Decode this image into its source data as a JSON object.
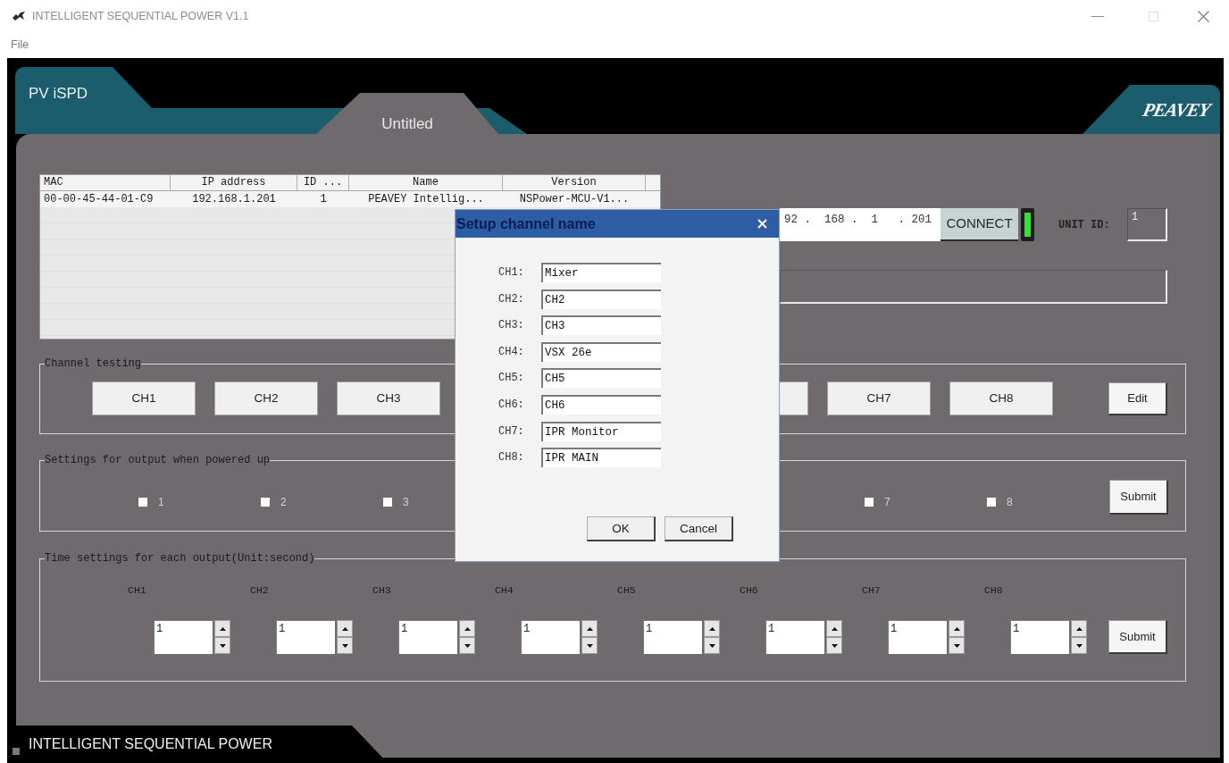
{
  "window": {
    "title": "INTELLIGENT SEQUENTIAL POWER V1.1"
  },
  "menu": [
    {
      "label": "File"
    }
  ],
  "header": {
    "app_name": "PV iSPD",
    "tab": {
      "label": "Untitled",
      "selected": true
    },
    "logo_text": "PEAVEY"
  },
  "device_table": {
    "columns": [
      "MAC",
      "IP address",
      "ID ...",
      "Name",
      "Version"
    ],
    "rows": [
      {
        "cells": [
          "00-00-45-44-01-C9",
          "192.168.1.201",
          "1",
          "PEAVEY Intellig...",
          "NSPower-MCU-V1..."
        ]
      }
    ]
  },
  "connection": {
    "ip_address": "92 .  168 .  1   . 201",
    "connect_button": "CONNECT",
    "connected": true,
    "unit_id_label": "UNIT ID:",
    "unit_id": "1"
  },
  "channel_testing": {
    "title": "Channel testing",
    "buttons": [
      {
        "kind": "button",
        "label": "CH1"
      },
      {
        "kind": "button",
        "label": "CH2"
      },
      {
        "kind": "button",
        "label": "CH3"
      },
      {
        "kind": "edge"
      },
      {
        "kind": "button",
        "label": "CH7"
      },
      {
        "kind": "button",
        "label": "CH8"
      }
    ],
    "edit_button": "Edit"
  },
  "power_up_outputs": {
    "title": "Settings for output when powered up",
    "outputs": [
      {
        "label": "1",
        "checked": false
      },
      {
        "label": "2",
        "checked": false
      },
      {
        "label": "3",
        "checked": false
      },
      {
        "label": "7",
        "checked": false
      },
      {
        "label": "8",
        "checked": false
      }
    ],
    "submit_button": "Submit"
  },
  "time_settings": {
    "title": "Time settings for each output(Unit:second)",
    "channels": [
      {
        "label": "CH1",
        "value": "1"
      },
      {
        "label": "CH2",
        "value": "1"
      },
      {
        "label": "CH3",
        "value": "1"
      },
      {
        "label": "CH4",
        "value": "1"
      },
      {
        "label": "CH5",
        "value": "1"
      },
      {
        "label": "CH6",
        "value": "1"
      },
      {
        "label": "CH7",
        "value": "1"
      },
      {
        "label": "CH8",
        "value": "1"
      }
    ],
    "submit_button": "Submit"
  },
  "dialog": {
    "title": "Setup channel name",
    "fields": [
      {
        "label": "CH1:",
        "value": "Mixer"
      },
      {
        "label": "CH2:",
        "value": "CH2"
      },
      {
        "label": "CH3:",
        "value": "CH3"
      },
      {
        "label": "CH4:",
        "value": "VSX 26e"
      },
      {
        "label": "CH5:",
        "value": "CH5"
      },
      {
        "label": "CH6:",
        "value": "CH6"
      },
      {
        "label": "CH7:",
        "value": "IPR Monitor"
      },
      {
        "label": "CH8:",
        "value": "IPR MAIN"
      }
    ],
    "buttons": [
      "OK",
      "Cancel"
    ]
  },
  "status_bar": {
    "text": "INTELLIGENT SEQUENTIAL POWER"
  }
}
